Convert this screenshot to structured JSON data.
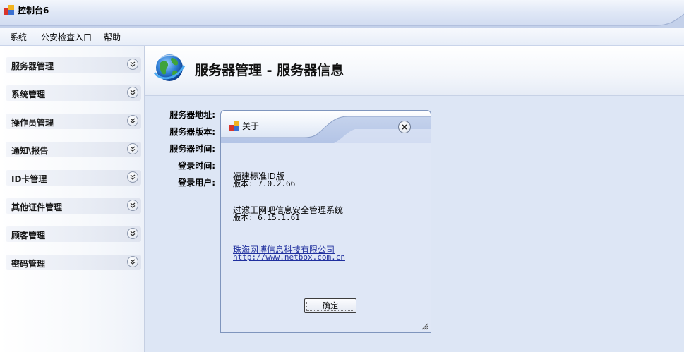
{
  "window": {
    "title": "控制台6"
  },
  "menu": {
    "items": [
      {
        "label": "系统"
      },
      {
        "label": "公安检查入口"
      },
      {
        "label": "帮助"
      }
    ]
  },
  "sidebar": {
    "items": [
      {
        "label": "服务器管理"
      },
      {
        "label": "系统管理"
      },
      {
        "label": "操作员管理"
      },
      {
        "label": "通知\\报告"
      },
      {
        "label": "ID卡管理"
      },
      {
        "label": "其他证件管理"
      },
      {
        "label": "顾客管理"
      },
      {
        "label": "密码管理"
      }
    ]
  },
  "main": {
    "title": "服务器管理 - 服务器信息",
    "info_labels": [
      "服务器地址:",
      "服务器版本:",
      "服务器时间:",
      "登录时间:",
      "登录用户:"
    ]
  },
  "about_dialog": {
    "title": "关于",
    "product1_name": "福建标准ID版",
    "product1_version": "版本: 7.0.2.66",
    "product2_name": "过滤王网吧信息安全管理系统",
    "product2_version": "版本: 6.15.1.61",
    "company_link": "珠海网博信息科技有限公司",
    "url_link": "http://www.netbox.com.cn",
    "ok_label": "确定"
  },
  "colors": {
    "accent": "#dde6f5",
    "link": "#1f2f9e"
  }
}
